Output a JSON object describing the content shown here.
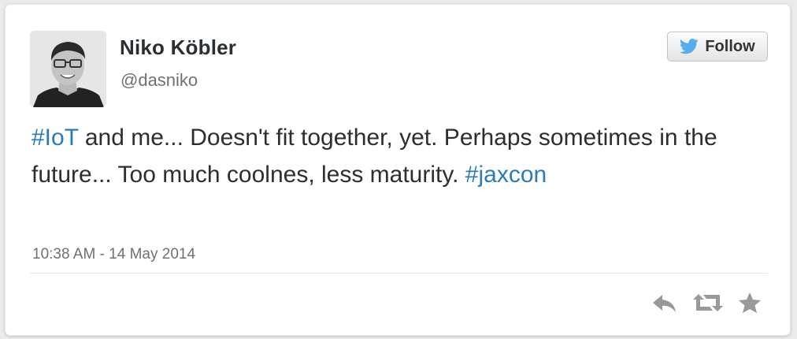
{
  "author": {
    "display_name": "Niko Köbler",
    "badge_glyph": "",
    "screen_name": "@dasniko",
    "avatar_icon": "profile-photo"
  },
  "follow_button": {
    "label": "Follow",
    "icon": "twitter-bird-icon"
  },
  "tweet": {
    "hashtag_1": "#IoT",
    "text_part_1": " and me... Doesn't fit together, yet. Perhaps sometimes in the future... Too much coolnes, less maturity. ",
    "hashtag_2": "#jaxcon",
    "timestamp": "10:38 AM - 14 May 2014"
  },
  "actions": [
    {
      "name": "reply",
      "icon": "reply-icon"
    },
    {
      "name": "retweet",
      "icon": "retweet-icon"
    },
    {
      "name": "favorite",
      "icon": "star-icon"
    }
  ],
  "colors": {
    "hashtag": "#2b7bb9",
    "text": "#292f33",
    "muted": "#707070",
    "twitter_blue": "#55acee",
    "action_gray": "#999999"
  }
}
